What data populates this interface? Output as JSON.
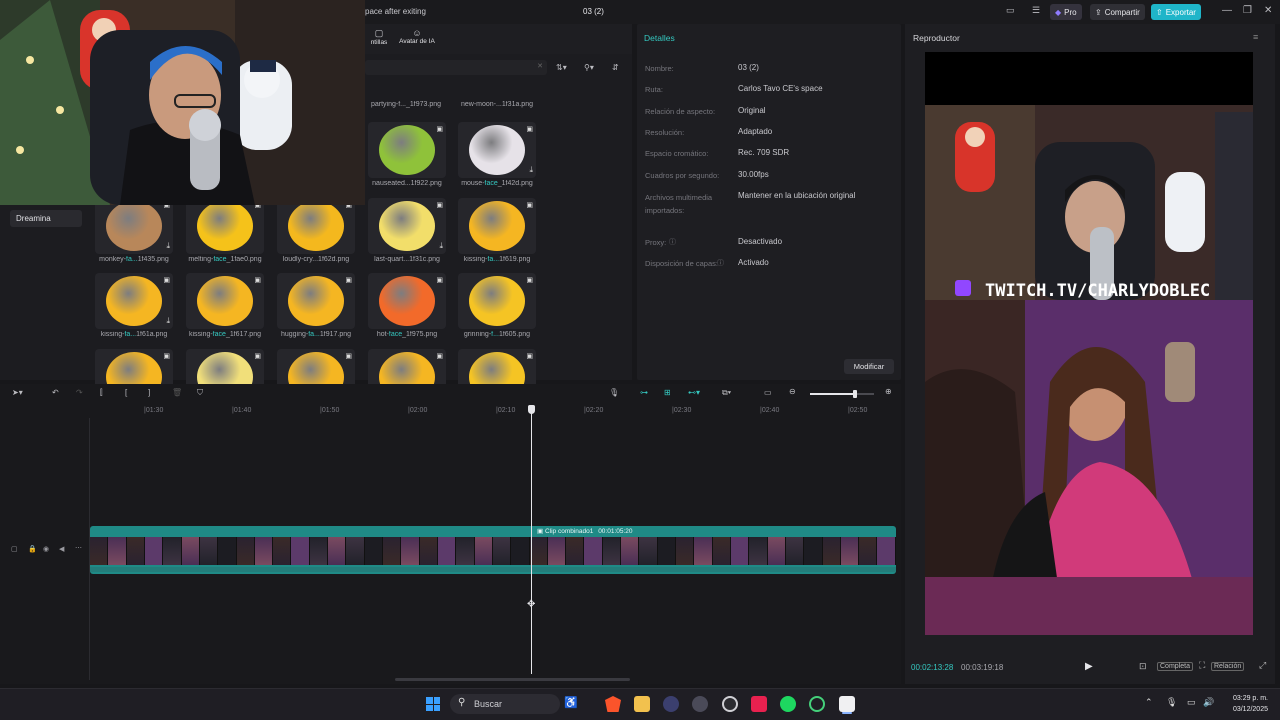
{
  "topbar": {
    "project_hint": "pace after exiting",
    "project_name": "03 (2)",
    "pro_label": "Pro",
    "share_label": "Compartir",
    "export_label": "Exportar"
  },
  "media": {
    "tabs": [
      {
        "label": "ntillas"
      },
      {
        "label": "Avatar de IA"
      }
    ],
    "sidebar_item": "Dreamina",
    "top_captions": [
      "partying-f..._1f973.png",
      "new-moon-...1f31a.png"
    ],
    "items": [
      {
        "name_pre": "nauseated...1f922.png",
        "name_hl": "",
        "name_post": "",
        "color": "#8fc23a",
        "dl": false
      },
      {
        "name_pre": "mouse-",
        "name_hl": "face",
        "name_post": "_1f42d.png",
        "color": "#e6e2e8",
        "dl": true
      },
      {
        "name_pre": "monkey-",
        "name_hl": "fa...",
        "name_post": "1f435.png",
        "color": "#b8875a",
        "dl": true
      },
      {
        "name_pre": "melting-",
        "name_hl": "face",
        "name_post": "_1fae0.png",
        "color": "#f5c21a",
        "dl": false
      },
      {
        "name_pre": "loudly-cry...1f62d.png",
        "name_hl": "",
        "name_post": "",
        "color": "#f4b81e",
        "dl": false
      },
      {
        "name_pre": "last-quart...1f31c.png",
        "name_hl": "",
        "name_post": "",
        "color": "#f2de6a",
        "dl": true
      },
      {
        "name_pre": "kissing-",
        "name_hl": "fa...",
        "name_post": "1f619.png",
        "color": "#f5b622",
        "dl": false
      },
      {
        "name_pre": "kissing-",
        "name_hl": "fa...",
        "name_post": "1f61a.png",
        "color": "#f5b622",
        "dl": true
      },
      {
        "name_pre": "kissing-",
        "name_hl": "face",
        "name_post": "_1f617.png",
        "color": "#f5b622",
        "dl": false
      },
      {
        "name_pre": "hugging-",
        "name_hl": "fa...",
        "name_post": "1f917.png",
        "color": "#f5b622",
        "dl": false
      },
      {
        "name_pre": "hot-",
        "name_hl": "face",
        "name_post": "_1f975.png",
        "color": "#f26a2a",
        "dl": false
      },
      {
        "name_pre": "grinning-",
        "name_hl": "f...",
        "name_post": "1f605.png",
        "color": "#f5c424",
        "dl": false
      },
      {
        "name_pre": "",
        "name_hl": "",
        "name_post": "",
        "color": "#f5b622",
        "dl": false
      },
      {
        "name_pre": "",
        "name_hl": "",
        "name_post": "",
        "color": "#f1df7a",
        "dl": false
      },
      {
        "name_pre": "",
        "name_hl": "",
        "name_post": "",
        "color": "#f5b622",
        "dl": false
      },
      {
        "name_pre": "",
        "name_hl": "",
        "name_post": "",
        "color": "#f5b622",
        "dl": false
      },
      {
        "name_pre": "",
        "name_hl": "",
        "name_post": "",
        "color": "#f5c424",
        "dl": false
      }
    ]
  },
  "details": {
    "title": "Detalles",
    "rows": [
      {
        "label": "Nombre:",
        "value": "03 (2)"
      },
      {
        "label": "Ruta:",
        "value": "Carlos Tavo CE's space"
      },
      {
        "label": "Relación de aspecto:",
        "value": "Original"
      },
      {
        "label": "Resolución:",
        "value": "Adaptado"
      },
      {
        "label": "Espacio cromático:",
        "value": "Rec. 709 SDR"
      },
      {
        "label": "Cuadros por segundo:",
        "value": "30.00fps"
      },
      {
        "label": "Archivos multimedia importados:",
        "value": "Mantener en la ubicación original"
      },
      {
        "label": "Proxy:",
        "value": "Desactivado"
      },
      {
        "label": "Disposición de capas:",
        "value": "Activado"
      }
    ],
    "modify_label": "Modificar"
  },
  "player": {
    "title": "Reproductor",
    "watermark": "TWITCH.TV/CHARLYDOBLEC",
    "current_time": "00:02:13:28",
    "total_time": "00:03:19:18",
    "full_label": "Completa",
    "ratio_label": "Relación"
  },
  "timeline": {
    "ticks": [
      "01:30",
      "01:40",
      "01:50",
      "02:00",
      "02:10",
      "02:20",
      "02:30",
      "02:40",
      "02:50"
    ],
    "clip_label": "Clip combinado1",
    "clip_duration": "00:01:05:20",
    "zoom_level": 0.7
  },
  "taskbar": {
    "search_placeholder": "Buscar",
    "time": "03:29 p. m.",
    "date": "03/12/2025"
  },
  "colors": {
    "accent": "#35c9c1",
    "export": "#1fb5c9",
    "clip": "#1f8a86"
  }
}
